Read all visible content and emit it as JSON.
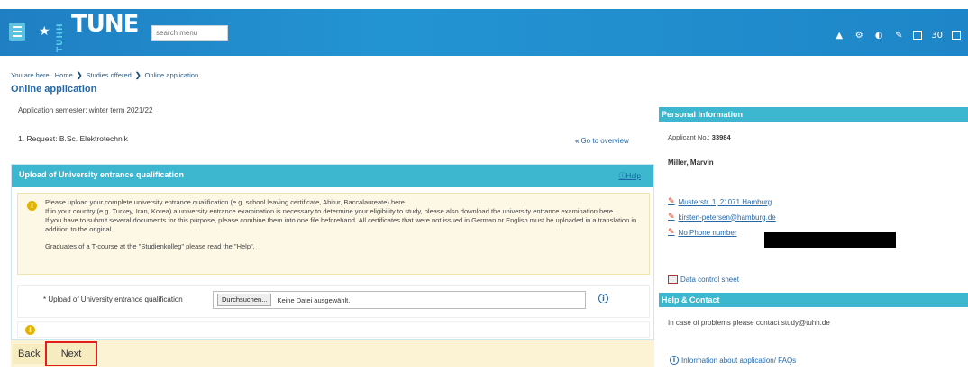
{
  "header": {
    "logo_vertical": "TUHH",
    "logo": "TUNE",
    "search_placeholder": "search menu",
    "counter": "30",
    "colors": {
      "bar": "#1f7fc2",
      "accent": "#3db6cf",
      "link": "#2468a8",
      "highlight": "#e21d1d"
    }
  },
  "breadcrumb": {
    "prefix": "You are here:",
    "items": [
      "Home",
      "Studies offered",
      "Online application"
    ]
  },
  "page_title": "Online application",
  "main": {
    "semester": "Application semester: winter term 2021/22",
    "request": "1. Request: B.Sc. Elektrotechnik",
    "goto_overview": "Go to overview",
    "upload": {
      "title": "Upload of University entrance qualification",
      "help": "Help",
      "info_lines": [
        "Please upload your complete university entrance qualification (e.g. school leaving certificate, Abitur, Baccalaureate) here.",
        "If in your country (e.g. Turkey, Iran, Korea) a university entrance examination is necessary to determine your eligibility to study, please also download the university entrance examination here.",
        "If you have to submit several documents for this purpose, please combine them into one file beforehand. All certificates that were not issued in German or English must be uploaded in a translation in addition to the original."
      ],
      "info_note": "Graduates of a T-course at the \"Studienkolleg\" please read the \"Help\".",
      "field_label": "* Upload of University entrance qualification",
      "browse": "Durchsuchen...",
      "no_file": "Keine Datei ausgewählt."
    }
  },
  "footer": {
    "back": "Back",
    "next": "Next"
  },
  "personal": {
    "title": "Personal Information",
    "applicant_label": "Applicant No.:",
    "applicant_no": "33984",
    "name": "Miller, Marvin",
    "address": "Musterstr. 1, 21071 Hamburg",
    "email": "kirsten-petersen@hamburg.de",
    "phone": "No Phone number",
    "data_sheet": "Data control sheet"
  },
  "help_contact": {
    "title": "Help & Contact",
    "text": "In case of problems please contact  study@tuhh.de",
    "faq": "Information about application/ FAQs"
  }
}
